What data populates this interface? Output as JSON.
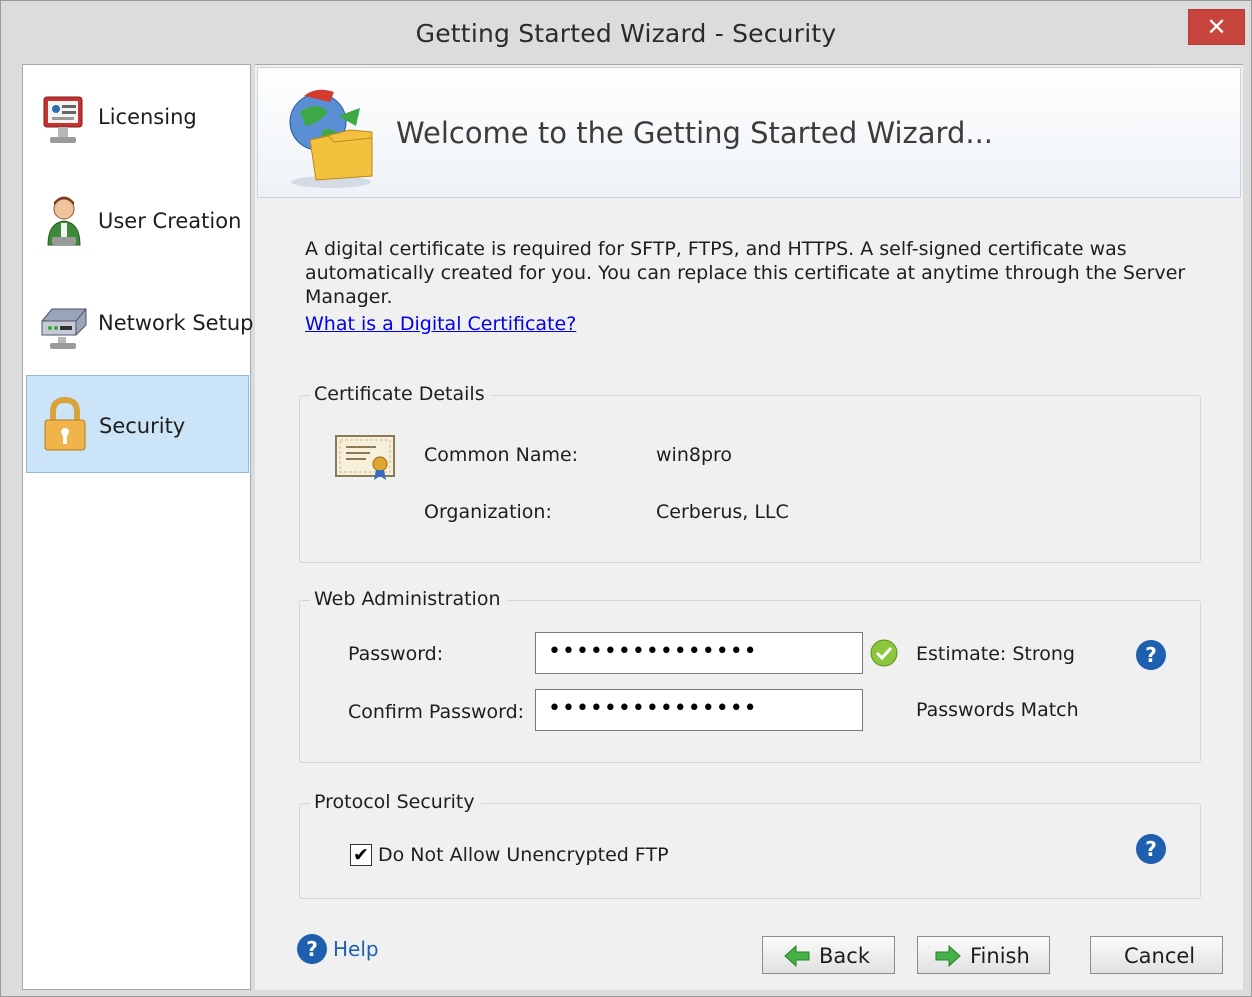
{
  "window": {
    "title": "Getting Started Wizard - Security",
    "close_glyph": "✕"
  },
  "sidebar": {
    "items": [
      {
        "label": "Licensing",
        "icon": "licensing-icon"
      },
      {
        "label": "User Creation",
        "icon": "user-icon"
      },
      {
        "label": "Network Setup",
        "icon": "network-icon"
      },
      {
        "label": "Security",
        "icon": "lock-icon",
        "active": true
      }
    ]
  },
  "banner": {
    "title": "Welcome to the Getting Started Wizard..."
  },
  "intro": {
    "text": "A digital certificate is required for SFTP, FTPS, and HTTPS.  A self-signed certificate was automatically created for you.  You can replace this certificate at anytime through the Server Manager.",
    "link": "What is a Digital Certificate?"
  },
  "certificate": {
    "group_label": "Certificate Details",
    "common_name_label": "Common Name:",
    "common_name_value": "win8pro",
    "organization_label": "Organization:",
    "organization_value": "Cerberus, LLC"
  },
  "web_admin": {
    "group_label": "Web Administration",
    "password_label": "Password:",
    "password_value": "•••••••••••••••",
    "confirm_label": "Confirm Password:",
    "confirm_value": "•••••••••••••••",
    "estimate": "Estimate: Strong",
    "match": "Passwords Match"
  },
  "protocol": {
    "group_label": "Protocol Security",
    "checkbox_label": "Do Not Allow Unencrypted FTP",
    "checked": true
  },
  "footer": {
    "help": "Help",
    "back": "Back",
    "finish": "Finish",
    "cancel": "Cancel"
  },
  "colors": {
    "accent": "#1f5fb0",
    "close": "#c7453c",
    "active_nav": "#cbe4f7"
  }
}
